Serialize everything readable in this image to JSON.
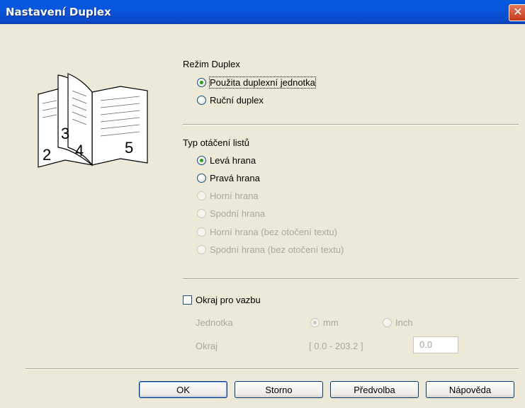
{
  "window": {
    "title": "Nastavení Duplex"
  },
  "duplex_mode": {
    "heading": "Režim Duplex",
    "options": [
      {
        "label": "Použita duplexní jednotka",
        "checked": true,
        "enabled": true
      },
      {
        "label": "Ruční duplex",
        "checked": false,
        "enabled": true
      }
    ]
  },
  "illustration": {
    "numbers": [
      "2",
      "3",
      "4",
      "5"
    ]
  },
  "flip": {
    "heading": "Typ otáčení listů",
    "options": [
      {
        "label": "Levá hrana",
        "checked": true,
        "enabled": true
      },
      {
        "label": "Pravá hrana",
        "checked": false,
        "enabled": true
      },
      {
        "label": "Horní hrana",
        "checked": false,
        "enabled": false
      },
      {
        "label": "Spodní hrana",
        "checked": false,
        "enabled": false
      },
      {
        "label": "Horní hrana (bez otočení textu)",
        "checked": false,
        "enabled": false
      },
      {
        "label": "Spodní hrana (bez otočení textu)",
        "checked": false,
        "enabled": false
      }
    ]
  },
  "binding": {
    "checkbox_label": "Okraj pro vazbu",
    "checked": false,
    "unit_label": "Jednotka",
    "unit_mm": "mm",
    "unit_inch": "Inch",
    "margin_label": "Okraj",
    "range": "[ 0.0 - 203.2 ]",
    "value": "0.0"
  },
  "buttons": {
    "ok": "OK",
    "cancel": "Storno",
    "defaults": "Předvolba",
    "help": "Nápověda"
  }
}
